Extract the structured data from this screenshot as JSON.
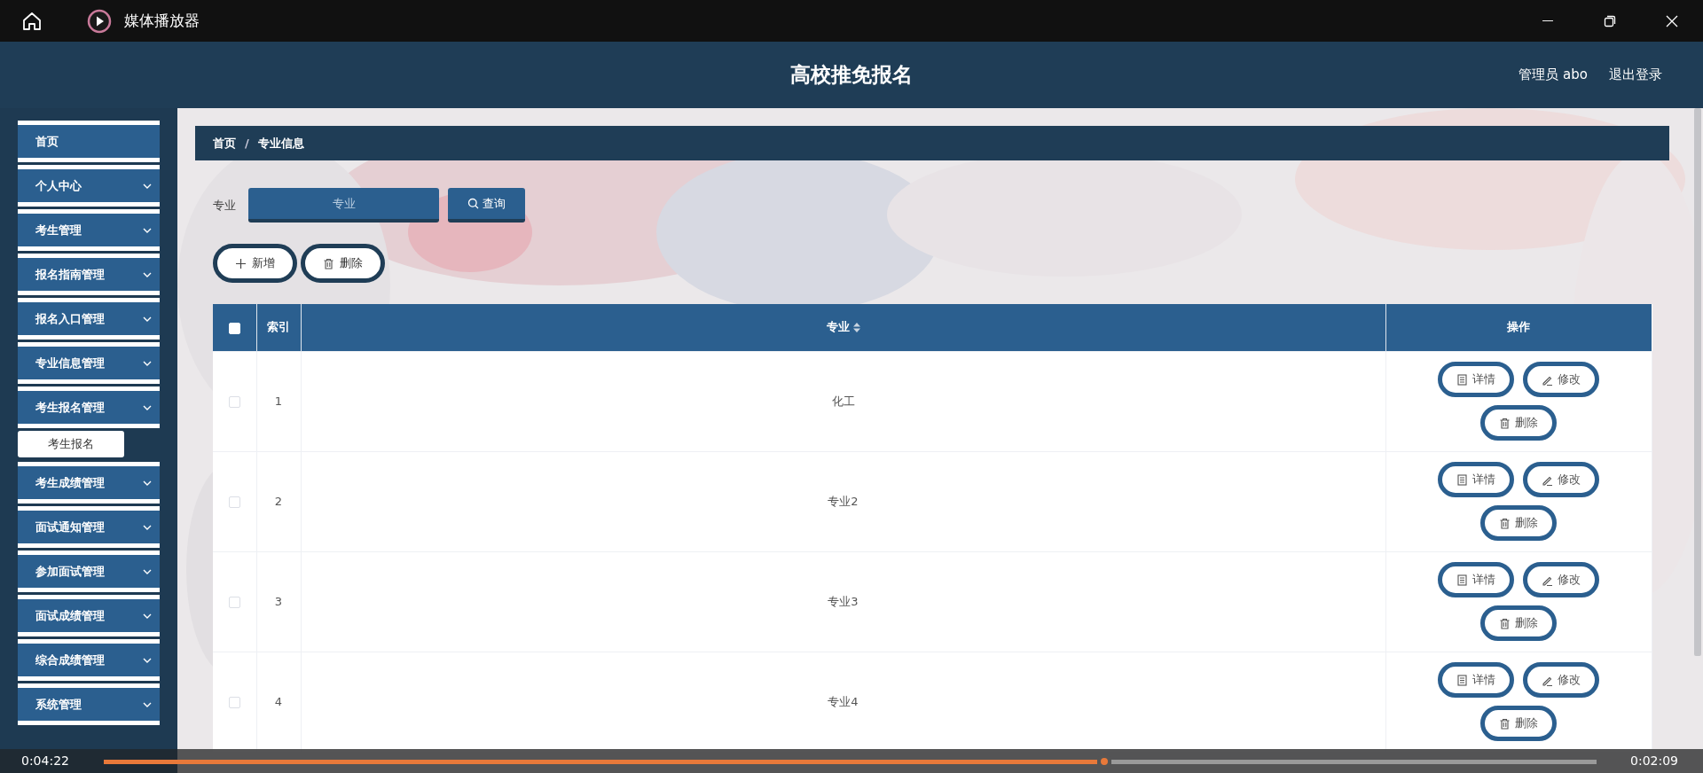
{
  "window": {
    "title": "媒体播放器"
  },
  "app": {
    "title": "高校推免报名",
    "user": "管理员 abo",
    "logout": "退出登录"
  },
  "sidebar": {
    "items": [
      {
        "label": "首页",
        "kind": "link"
      },
      {
        "label": "个人中心",
        "kind": "menu"
      },
      {
        "label": "考生管理",
        "kind": "menu"
      },
      {
        "label": "报名指南管理",
        "kind": "menu"
      },
      {
        "label": "报名入口管理",
        "kind": "menu"
      },
      {
        "label": "专业信息管理",
        "kind": "menu"
      },
      {
        "label": "考生报名管理",
        "kind": "menu",
        "children": [
          {
            "label": "考生报名"
          }
        ]
      },
      {
        "label": "考生成绩管理",
        "kind": "menu"
      },
      {
        "label": "面试通知管理",
        "kind": "menu"
      },
      {
        "label": "参加面试管理",
        "kind": "menu"
      },
      {
        "label": "面试成绩管理",
        "kind": "menu"
      },
      {
        "label": "综合成绩管理",
        "kind": "menu"
      },
      {
        "label": "系统管理",
        "kind": "menu"
      }
    ]
  },
  "breadcrumb": {
    "items": [
      "首页",
      "专业信息"
    ],
    "separator": "/"
  },
  "search": {
    "label": "专业",
    "placeholder": "专业",
    "button": "查询"
  },
  "actions": [
    {
      "kind": "add",
      "label": "新增"
    },
    {
      "kind": "delete",
      "label": "删除"
    }
  ],
  "table": {
    "select_all": {
      "checked": false
    },
    "columns": [
      {
        "label": "索引",
        "sortable": false
      },
      {
        "label": "专业",
        "sortable": true
      },
      {
        "label": "操作",
        "sortable": false
      }
    ],
    "rows": [
      {
        "checked": false,
        "index": "1",
        "major": "化工",
        "actions": [
          {
            "kind": "detail",
            "label": "详情"
          },
          {
            "kind": "edit",
            "label": "修改"
          },
          {
            "kind": "delete",
            "label": "删除"
          }
        ]
      },
      {
        "checked": false,
        "index": "2",
        "major": "专业2",
        "actions": [
          {
            "kind": "detail",
            "label": "详情"
          },
          {
            "kind": "edit",
            "label": "修改"
          },
          {
            "kind": "delete",
            "label": "删除"
          }
        ]
      },
      {
        "checked": false,
        "index": "3",
        "major": "专业3",
        "actions": [
          {
            "kind": "detail",
            "label": "详情"
          },
          {
            "kind": "edit",
            "label": "修改"
          },
          {
            "kind": "delete",
            "label": "删除"
          }
        ]
      },
      {
        "checked": false,
        "index": "4",
        "major": "专业4",
        "actions": [
          {
            "kind": "detail",
            "label": "详情"
          },
          {
            "kind": "edit",
            "label": "修改"
          },
          {
            "kind": "delete",
            "label": "删除"
          }
        ]
      }
    ]
  },
  "player": {
    "elapsed": "0:04:22",
    "remaining": "0:02:09",
    "level": 0.67
  }
}
